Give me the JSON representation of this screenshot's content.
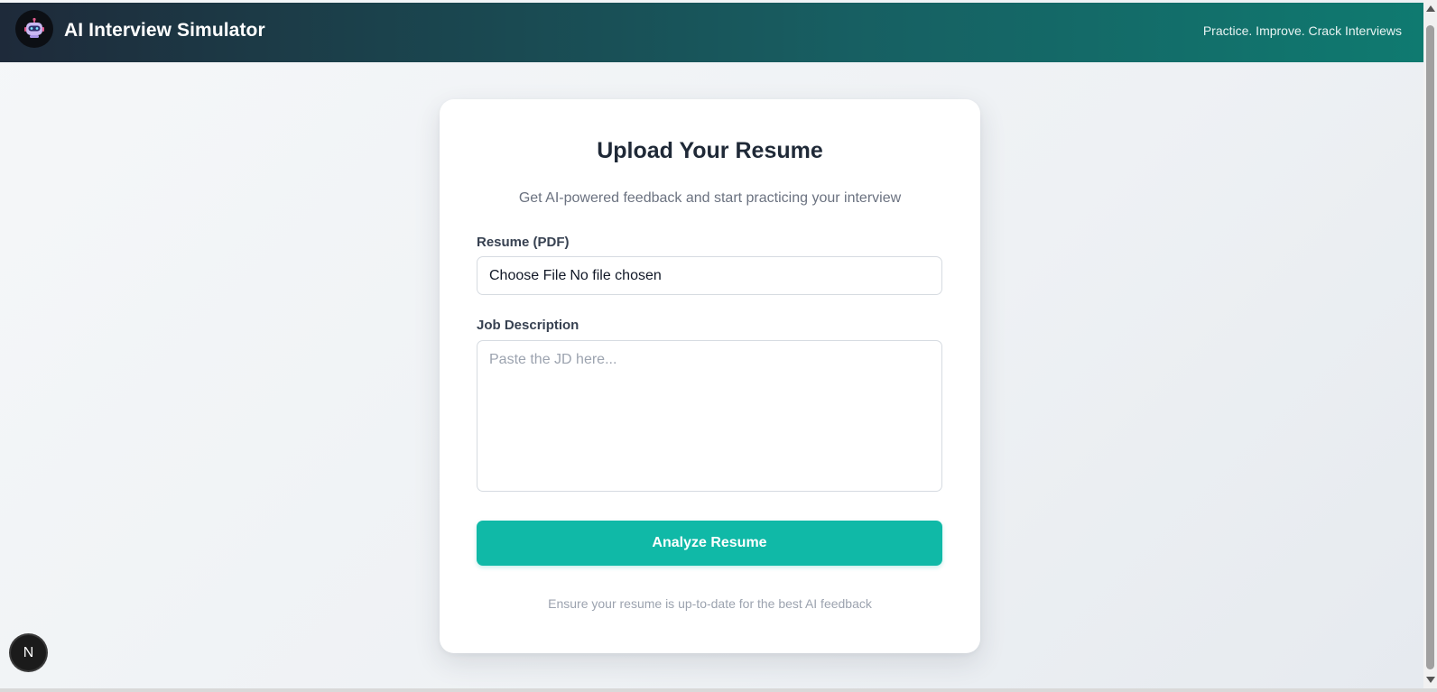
{
  "header": {
    "title": "AI Interview Simulator",
    "tagline": "Practice. Improve. Crack Interviews",
    "logo_icon": "robot-icon"
  },
  "card": {
    "title": "Upload Your Resume",
    "subtitle": "Get AI-powered feedback and start practicing your interview",
    "resume_label": "Resume (PDF)",
    "file_button_label": "Choose File",
    "file_status": "No file chosen",
    "jd_label": "Job Description",
    "jd_placeholder": "Paste the JD here...",
    "jd_value": "",
    "submit_label": "Analyze Resume",
    "footnote": "Ensure your resume is up-to-date for the best AI feedback"
  },
  "dev_badge": {
    "label": "N"
  },
  "colors": {
    "header_start": "#1e2a3a",
    "header_end": "#0f7a70",
    "accent": "#10b9a7",
    "title_text": "#1f2937",
    "muted_text": "#6b7280"
  }
}
